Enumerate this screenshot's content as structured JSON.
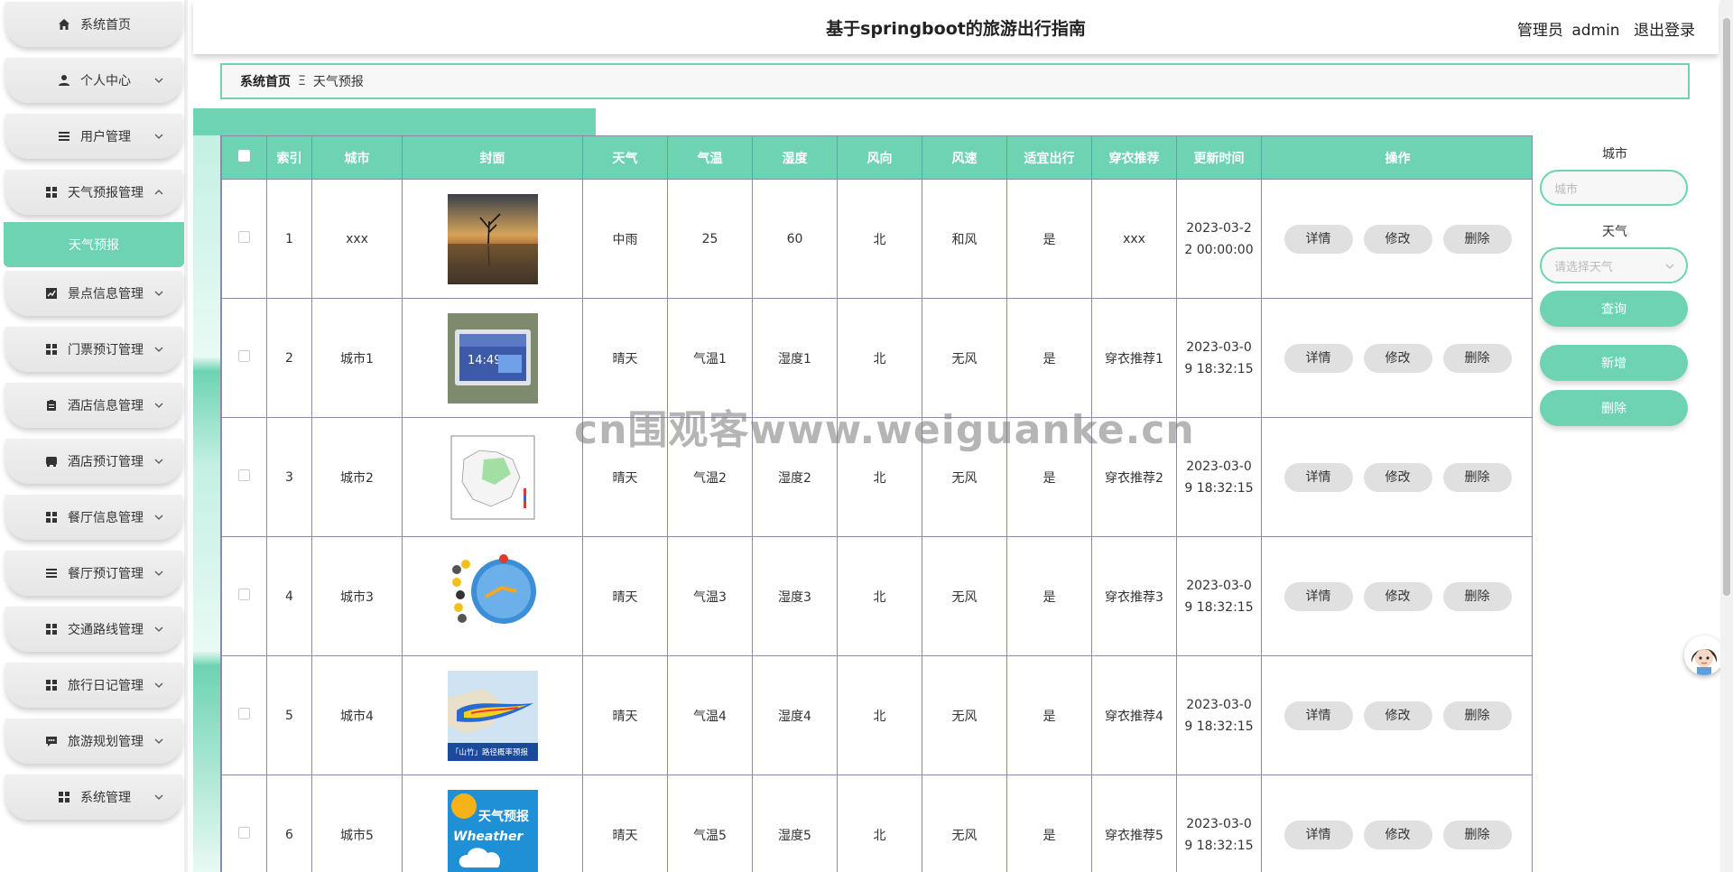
{
  "header": {
    "title": "基于springboot的旅游出行指南",
    "user_role": "管理员",
    "user_name": "admin",
    "logout": "退出登录"
  },
  "sidebar": {
    "items": [
      {
        "label": "系统首页",
        "icon": "home-icon"
      },
      {
        "label": "个人中心",
        "icon": "user-icon"
      },
      {
        "label": "用户管理",
        "icon": "list-icon"
      },
      {
        "label": "天气预报管理",
        "icon": "grid-icon",
        "expanded": true
      },
      {
        "label": "景点信息管理",
        "icon": "chart-icon"
      },
      {
        "label": "门票预订管理",
        "icon": "grid-icon"
      },
      {
        "label": "酒店信息管理",
        "icon": "clipboard-icon"
      },
      {
        "label": "酒店预订管理",
        "icon": "bus-icon"
      },
      {
        "label": "餐厅信息管理",
        "icon": "grid-icon"
      },
      {
        "label": "餐厅预订管理",
        "icon": "list-icon"
      },
      {
        "label": "交通路线管理",
        "icon": "grid-icon"
      },
      {
        "label": "旅行日记管理",
        "icon": "grid-icon"
      },
      {
        "label": "旅游规划管理",
        "icon": "chat-icon"
      },
      {
        "label": "系统管理",
        "icon": "grid-icon"
      }
    ],
    "sub_active": "天气预报"
  },
  "breadcrumb": {
    "home": "系统首页",
    "separator": "Ξ",
    "current": "天气预报"
  },
  "table": {
    "headers": [
      "索引",
      "城市",
      "封面",
      "天气",
      "气温",
      "湿度",
      "风向",
      "风速",
      "适宜出行",
      "穿衣推荐",
      "更新时间",
      "操作"
    ],
    "rows": [
      {
        "index": "1",
        "city": "xxx",
        "cover": "lake-tree",
        "weather": "中雨",
        "temp": "25",
        "humidity": "60",
        "wind_dir": "北",
        "wind_speed": "和风",
        "suitable": "是",
        "clothing": "xxx",
        "time": "2023-03-22 00:00:00"
      },
      {
        "index": "2",
        "city": "城市1",
        "cover": "weather-station",
        "weather": "晴天",
        "temp": "气温1",
        "humidity": "湿度1",
        "wind_dir": "北",
        "wind_speed": "无风",
        "suitable": "是",
        "clothing": "穿衣推荐1",
        "time": "2023-03-09 18:32:15"
      },
      {
        "index": "3",
        "city": "城市2",
        "cover": "weather-map",
        "weather": "晴天",
        "temp": "气温2",
        "humidity": "湿度2",
        "wind_dir": "北",
        "wind_speed": "无风",
        "suitable": "是",
        "clothing": "穿衣推荐2",
        "time": "2023-03-09 18:32:15"
      },
      {
        "index": "4",
        "city": "城市3",
        "cover": "weather-dial",
        "weather": "晴天",
        "temp": "气温3",
        "humidity": "湿度3",
        "wind_dir": "北",
        "wind_speed": "无风",
        "suitable": "是",
        "clothing": "穿衣推荐3",
        "time": "2023-03-09 18:32:15"
      },
      {
        "index": "5",
        "city": "城市4",
        "cover": "typhoon-map",
        "weather": "晴天",
        "temp": "气温4",
        "humidity": "湿度4",
        "wind_dir": "北",
        "wind_speed": "无风",
        "suitable": "是",
        "clothing": "穿衣推荐4",
        "time": "2023-03-09 18:32:15"
      },
      {
        "index": "6",
        "city": "城市5",
        "cover": "weather-banner",
        "weather": "晴天",
        "temp": "气温5",
        "humidity": "湿度5",
        "wind_dir": "北",
        "wind_speed": "无风",
        "suitable": "是",
        "clothing": "穿衣推荐5",
        "time": "2023-03-09 18:32:15"
      }
    ],
    "actions": {
      "detail": "详情",
      "edit": "修改",
      "delete": "删除"
    }
  },
  "covers_text": {
    "typhoon_caption": "「山竹」路径概率预报",
    "banner_title": "天气预报",
    "banner_sub": "Wheather",
    "clock": "14:49"
  },
  "search": {
    "city_label": "城市",
    "city_placeholder": "城市",
    "weather_label": "天气",
    "weather_placeholder": "请选择天气",
    "query_button": "查询",
    "add_button": "新增",
    "delete_button": "删除"
  },
  "watermark": "cn围观客www.weiguanke.cn",
  "colors": {
    "accent": "#6dd3b3",
    "border": "#8a8ab0",
    "button": "#e0e0e0"
  }
}
